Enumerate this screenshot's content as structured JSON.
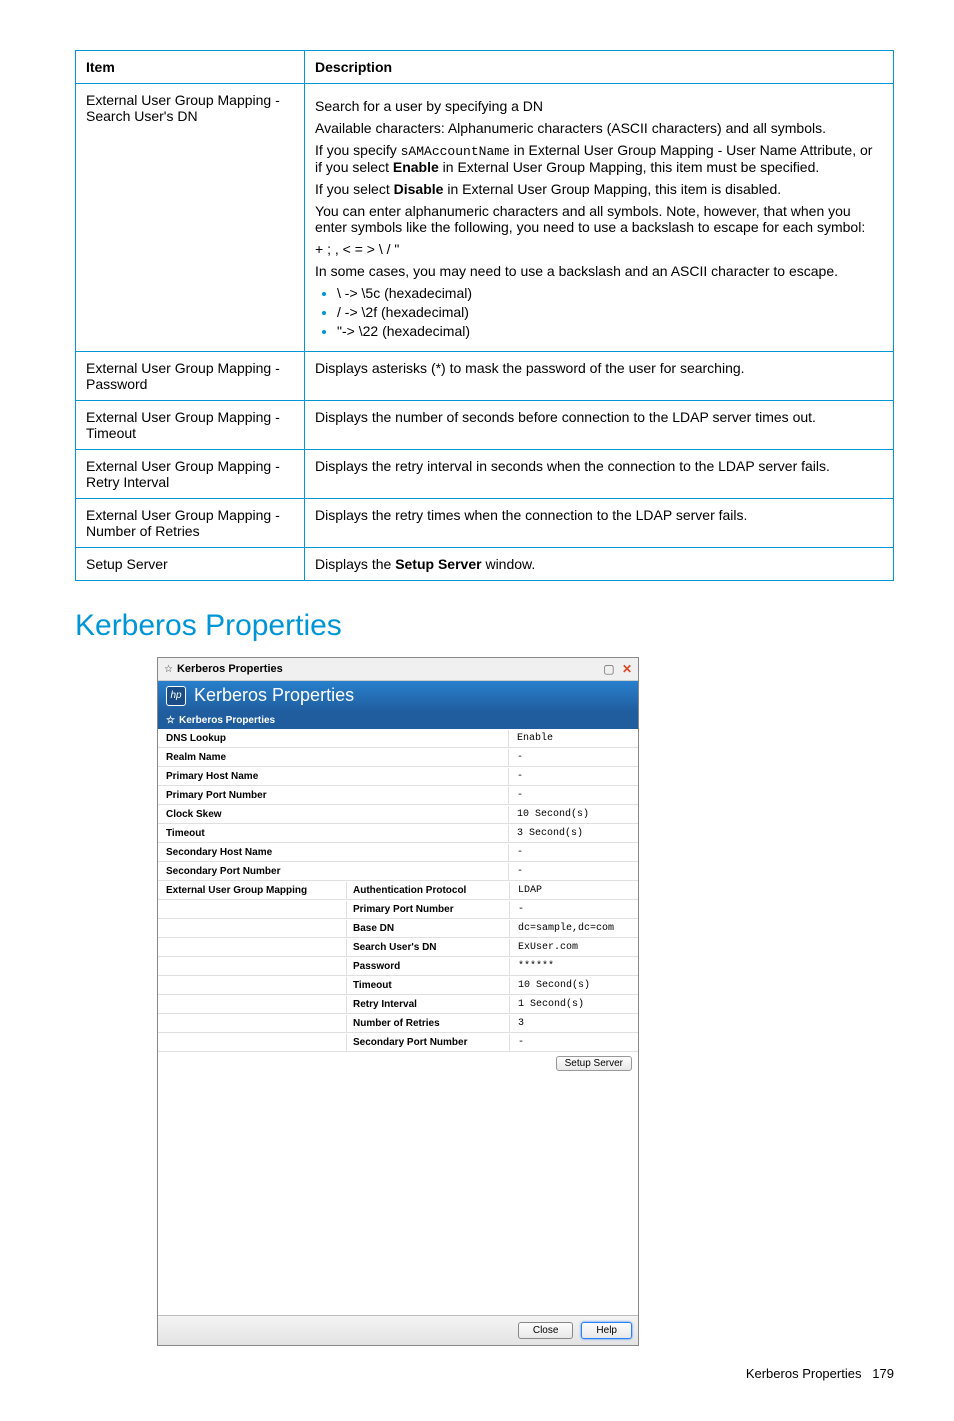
{
  "table": {
    "headers": {
      "item": "Item",
      "desc": "Description"
    },
    "rows": [
      {
        "item": "External User Group Mapping - Search User's DN",
        "desc": {
          "p1": "Search for a user by specifying a DN",
          "p2": "Available characters: Alphanumeric characters (ASCII characters) and all symbols.",
          "p3a": "If you specify ",
          "p3code": "sAMAccountName",
          "p3b": " in External User Group Mapping - User Name Attribute, or if you select ",
          "p3bold": "Enable",
          "p3c": " in External User Group Mapping, this item must be specified.",
          "p4a": "If you select ",
          "p4bold": "Disable",
          "p4b": " in External User Group Mapping, this item is disabled.",
          "p5": "You can enter alphanumeric characters and all symbols. Note, however, that when you enter symbols like the following, you need to use a backslash to escape for each symbol:",
          "p6": "+ ; , < = > \\ / \"",
          "p7": "In some cases, you may need to use a backslash and an ASCII character to escape.",
          "li1": "\\ -> \\5c (hexadecimal)",
          "li2": "/ -> \\2f (hexadecimal)",
          "li3": "\"-> \\22 (hexadecimal)"
        }
      },
      {
        "item": "External User Group Mapping - Password",
        "desc": "Displays asterisks (*) to mask the password of the user for searching."
      },
      {
        "item": "External User Group Mapping - Timeout",
        "desc": "Displays the number of seconds before connection to the LDAP server times out."
      },
      {
        "item": "External User Group Mapping - Retry Interval",
        "desc": "Displays the retry interval in seconds when the connection to the LDAP server fails."
      },
      {
        "item": "External User Group Mapping - Number of Retries",
        "desc": "Displays the retry times when the connection to the LDAP server fails."
      },
      {
        "item": "Setup Server",
        "desc_a": "Displays the ",
        "desc_bold": "Setup Server",
        "desc_b": " window."
      }
    ]
  },
  "section_heading": "Kerberos Properties",
  "dialog": {
    "title": "Kerberos Properties",
    "banner": "Kerberos Properties",
    "subbar": "Kerberos Properties",
    "rows2": [
      {
        "label": "DNS Lookup",
        "value": "Enable"
      },
      {
        "label": "Realm Name",
        "value": "-"
      },
      {
        "label": "Primary Host Name",
        "value": "-"
      },
      {
        "label": "Primary Port Number",
        "value": "-"
      },
      {
        "label": "Clock Skew",
        "value": "10 Second(s)"
      },
      {
        "label": "Timeout",
        "value": "3 Second(s)"
      },
      {
        "label": "Secondary Host Name",
        "value": "-"
      },
      {
        "label": "Secondary Port Number",
        "value": "-"
      }
    ],
    "group_label": "External User Group Mapping",
    "rows3": [
      {
        "label": "Authentication Protocol",
        "value": "LDAP"
      },
      {
        "label": "Primary Port Number",
        "value": "-"
      },
      {
        "label": "Base DN",
        "value": "dc=sample,dc=com"
      },
      {
        "label": "Search User's DN",
        "value": "ExUser.com"
      },
      {
        "label": "Password",
        "value": "******"
      },
      {
        "label": "Timeout",
        "value": "10 Second(s)"
      },
      {
        "label": "Retry Interval",
        "value": "1 Second(s)"
      },
      {
        "label": "Number of Retries",
        "value": "3"
      },
      {
        "label": "Secondary Port Number",
        "value": "-"
      }
    ],
    "setup_btn": "Setup Server",
    "close_btn": "Close",
    "help_btn": "Help"
  },
  "footer": {
    "label": "Kerberos Properties",
    "page": "179"
  }
}
